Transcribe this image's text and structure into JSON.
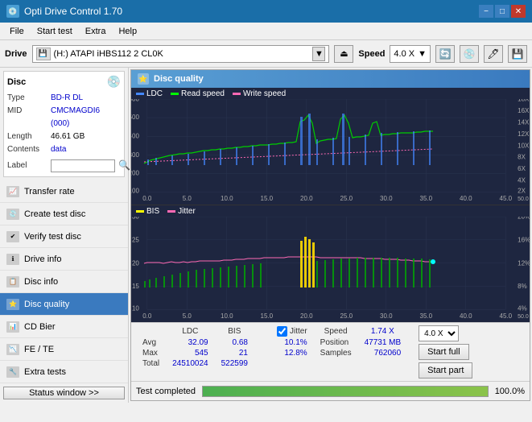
{
  "titlebar": {
    "title": "Opti Drive Control 1.70",
    "icon": "disc",
    "minimize": "−",
    "maximize": "□",
    "close": "✕"
  },
  "menubar": {
    "items": [
      "File",
      "Start test",
      "Extra",
      "Help"
    ]
  },
  "toolbar": {
    "drive_label": "Drive",
    "drive_value": "(H:) ATAPI iHBS112  2 CL0K",
    "speed_label": "Speed",
    "speed_value": "4.0 X"
  },
  "disc": {
    "title": "Disc",
    "type_label": "Type",
    "type_value": "BD-R DL",
    "mid_label": "MID",
    "mid_value": "CMCMAGDI6 (000)",
    "length_label": "Length",
    "length_value": "46.61 GB",
    "contents_label": "Contents",
    "contents_value": "data",
    "label_label": "Label"
  },
  "nav": {
    "items": [
      {
        "id": "transfer-rate",
        "label": "Transfer rate",
        "icon": "📈"
      },
      {
        "id": "create-test-disc",
        "label": "Create test disc",
        "icon": "💿"
      },
      {
        "id": "verify-test-disc",
        "label": "Verify test disc",
        "icon": "✔"
      },
      {
        "id": "drive-info",
        "label": "Drive info",
        "icon": "ℹ"
      },
      {
        "id": "disc-info",
        "label": "Disc info",
        "icon": "📋"
      },
      {
        "id": "disc-quality",
        "label": "Disc quality",
        "icon": "⭐",
        "active": true
      },
      {
        "id": "cd-bier",
        "label": "CD Bier",
        "icon": "📊"
      },
      {
        "id": "fe-te",
        "label": "FE / TE",
        "icon": "📉"
      },
      {
        "id": "extra-tests",
        "label": "Extra tests",
        "icon": "🔧"
      }
    ],
    "status_btn": "Status window >>"
  },
  "content": {
    "title": "Disc quality",
    "icon": "⭐"
  },
  "chart1": {
    "legend": [
      {
        "label": "LDC",
        "color": "#0000ff"
      },
      {
        "label": "Read speed",
        "color": "#00ff00"
      },
      {
        "label": "Write speed",
        "color": "#ff69b4"
      }
    ],
    "y_max": 600,
    "y_right_max": 18,
    "x_max": 50
  },
  "chart2": {
    "legend": [
      {
        "label": "BIS",
        "color": "#ffff00"
      },
      {
        "label": "Jitter",
        "color": "#ff69b4"
      }
    ],
    "y_max": 30,
    "y_right_max": 20,
    "x_max": 50
  },
  "stats": {
    "columns": [
      "LDC",
      "BIS",
      "",
      "Jitter",
      "Speed",
      ""
    ],
    "avg_label": "Avg",
    "max_label": "Max",
    "total_label": "Total",
    "avg_ldc": "32.09",
    "avg_bis": "0.68",
    "avg_jitter": "10.1%",
    "max_ldc": "545",
    "max_bis": "21",
    "max_jitter": "12.8%",
    "total_ldc": "24510024",
    "total_bis": "522599",
    "speed_label": "Speed",
    "speed_value": "1.74 X",
    "speed_select": "4.0 X",
    "position_label": "Position",
    "position_value": "47731 MB",
    "samples_label": "Samples",
    "samples_value": "762060",
    "jitter_checked": true,
    "jitter_label": "Jitter",
    "btn_full": "Start full",
    "btn_part": "Start part"
  },
  "progressbar": {
    "status_text": "Test completed",
    "progress": 100,
    "progress_text": "100.0%"
  }
}
